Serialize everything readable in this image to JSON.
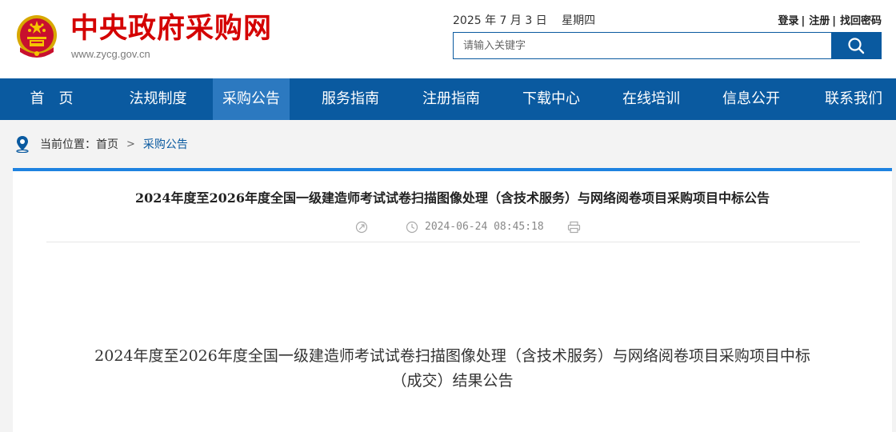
{
  "site": {
    "title": "中央政府采购网",
    "url": "www.zycg.gov.cn"
  },
  "header": {
    "date": "2025 年 7 月 3 日　 星期四",
    "login": "登录",
    "register": "注册",
    "recover": "找回密码",
    "separator": "|"
  },
  "search": {
    "placeholder": "请输入关键字",
    "button_icon": "search-icon"
  },
  "nav": {
    "items": [
      {
        "label": "首　页"
      },
      {
        "label": "法规制度"
      },
      {
        "label": "采购公告"
      },
      {
        "label": "服务指南"
      },
      {
        "label": "注册指南"
      },
      {
        "label": "下载中心"
      },
      {
        "label": "在线培训"
      },
      {
        "label": "信息公开"
      },
      {
        "label": "联系我们"
      }
    ],
    "active_index": 2
  },
  "breadcrumb": {
    "prefix": "当前位置：",
    "home": "首页",
    "arrow": ">",
    "current": "采购公告"
  },
  "article": {
    "title": "2024年度至2026年度全国一级建造师考试试卷扫描图像处理（含技术服务）与网络阅卷项目采购项目中标公告",
    "timestamp": "2024-06-24 08:45:18",
    "body_title_line1": "2024年度至2026年度全国一级建造师考试试卷扫描图像处理（含技术服务）与网络阅卷项目采购项目中标",
    "body_title_line2": "（成交）结果公告"
  },
  "colors": {
    "brand_blue": "#0a5aa0",
    "active_nav": "#2c79c0",
    "title_red": "#d40000",
    "accent_line": "#1e82e0"
  }
}
